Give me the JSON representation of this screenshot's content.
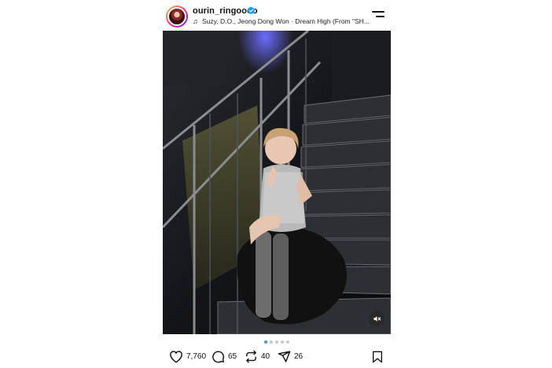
{
  "header": {
    "username": "ourin_ringoooo",
    "music": "Suzy, D.O., Jeong Dong Won · Dream High (From \"SH..."
  },
  "carousel": {
    "total": 5,
    "active_index": 0
  },
  "actions": {
    "likes": "7,760",
    "comments": "65",
    "reposts": "40",
    "shares": "26"
  },
  "icons": {
    "verified": "verified-badge-icon",
    "music": "music-note-icon",
    "menu": "menu-icon",
    "mute": "mute-icon",
    "like": "heart-icon",
    "comment": "comment-icon",
    "repost": "repost-icon",
    "share": "send-icon",
    "save": "bookmark-icon"
  },
  "colors": {
    "accent": "#3897f0",
    "verified": "#1d9bf0",
    "text": "#111111"
  }
}
